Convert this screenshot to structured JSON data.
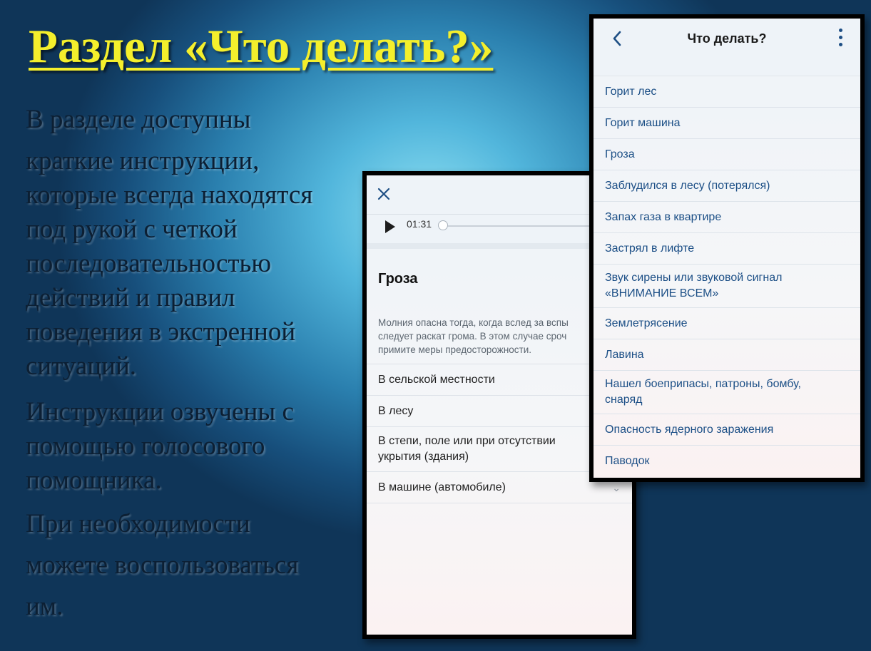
{
  "slide": {
    "title": "Раздел «Что делать?»",
    "para1_line1": "В разделе доступны",
    "para1_rest": "краткие инструкции,\nкоторые всегда находятся\nпод рукой с четкой\nпоследовательностью\nдействий и правил\nповедения в экстренной\nситуаций.",
    "para2": "Инструкции озвучены с\nпомощью голосового\nпомощника.",
    "para3": "При необходимости\nможете воспользоваться\nим."
  },
  "detail_screen": {
    "player_time": "01:31",
    "title": "Гроза",
    "description": "Молния опасна тогда, когда вслед за вспы\nследует раскат грома. В этом случае сроч\nпримите меры предосторожности.",
    "sections": [
      "В сельской местности",
      "В лесу",
      "В степи, поле или при отсутствии укрытия (здания)",
      "В машине (автомобиле)"
    ]
  },
  "list_screen": {
    "title": "Что делать?",
    "items": [
      "Горит лес",
      "Горит машина",
      "Гроза",
      "Заблудился в лесу (потерялся)",
      "Запах газа в квартире",
      "Застрял в лифте",
      "Звук сирены или звуковой сигнал «ВНИМАНИЕ ВСЕМ»",
      "Землетрясение",
      "Лавина",
      "Нашел боеприпасы, патроны, бомбу, снаряд",
      "Опасность ядерного заражения",
      "Паводок"
    ]
  },
  "colors": {
    "title": "#f4ef2c",
    "link_text": "#1c4f86",
    "accent_icon": "#1d4e84"
  },
  "icons": [
    "close-icon",
    "play-icon",
    "chevron-left-icon",
    "more-vertical-icon",
    "chevron-down-icon"
  ]
}
